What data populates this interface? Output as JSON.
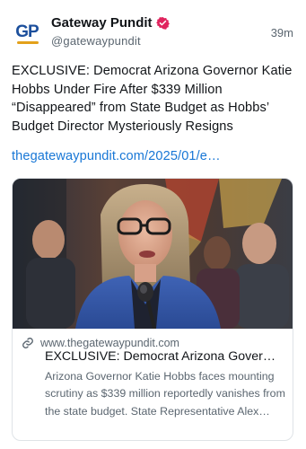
{
  "author": {
    "display_name": "Gateway Pundit",
    "handle": "@gatewaypundit",
    "avatar_initials": "GP",
    "verified_icon": "verified-badge-icon",
    "brand_color": "#1c4f9c",
    "accent_color": "#e3a11b"
  },
  "post": {
    "timestamp": "39m",
    "text": "EXCLUSIVE: Democrat Arizona Governor Katie Hobbs Under Fire After $339 Million “Disappeared” from State Budget as Hobbs’ Budget Director Mysteriously Resigns",
    "link_text": "thegatewaypundit.com/2025/01/e…",
    "link_color": "#1877d6"
  },
  "link_card": {
    "domain": "www.thegatewaypundit.com",
    "title": "EXCLUSIVE: Democrat Arizona Gover…",
    "description": "Arizona Governor Katie Hobbs faces mounting scrutiny as $339 million reportedly vanishes from the state budget. State Representative Alex Kolodin demands acco…",
    "image_subject": "woman-speaking-at-podium-photo"
  }
}
